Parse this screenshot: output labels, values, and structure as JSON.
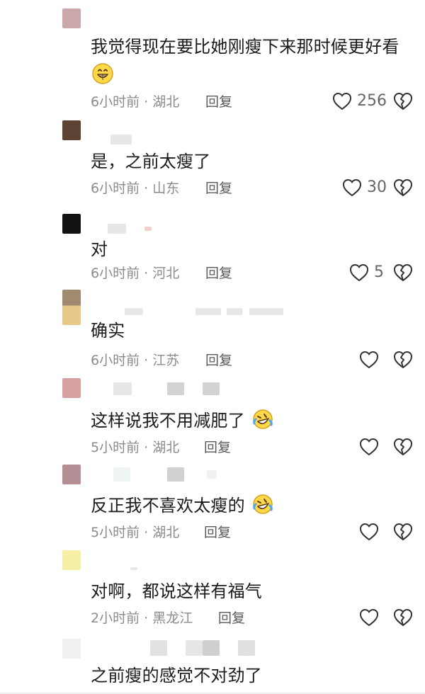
{
  "comments": [
    {
      "avatar_color": "#c9a7aa",
      "text": "我觉得现在要比她刚瘦下来那时候更好看",
      "emoji_name": "grinning-face-emoji",
      "time": "6小时前",
      "location": "湖北",
      "reply_label": "回复",
      "likes": "256",
      "liked": false
    },
    {
      "avatar_color": "#5b4233",
      "text": "是，之前太瘦了",
      "time": "6小时前",
      "location": "山东",
      "reply_label": "回复",
      "likes": "30",
      "liked": false
    },
    {
      "avatar_color": "#111111",
      "text": "对",
      "time": "6小时前",
      "location": "河北",
      "reply_label": "回复",
      "likes": "5",
      "liked": false
    },
    {
      "avatar_color": "#a08a70",
      "text": "确实",
      "time": "6小时前",
      "location": "江苏",
      "reply_label": "回复",
      "likes": "",
      "liked": false
    },
    {
      "avatar_color": "#d9a0a0",
      "text": "这样说我不用减肥了",
      "emoji_name": "rolling-on-the-floor-laughing-emoji",
      "time": "5小时前",
      "location": "湖北",
      "reply_label": "回复",
      "likes": "",
      "liked": false
    },
    {
      "avatar_color": "#b38e94",
      "text": "反正我不喜欢太瘦的",
      "emoji_name": "rolling-on-the-floor-laughing-emoji",
      "time": "5小时前",
      "location": "湖北",
      "reply_label": "回复",
      "likes": "",
      "liked": false
    },
    {
      "avatar_color": "#f6f0a6",
      "text": "对啊，都说这样有福气",
      "time": "2小时前",
      "location": "黑龙江",
      "reply_label": "回复",
      "likes": "",
      "liked": false
    },
    {
      "avatar_color": "#f0f0f0",
      "text": "之前瘦的感觉不对劲了",
      "time": "",
      "location": "",
      "reply_label": "",
      "likes": "",
      "liked": false
    }
  ]
}
